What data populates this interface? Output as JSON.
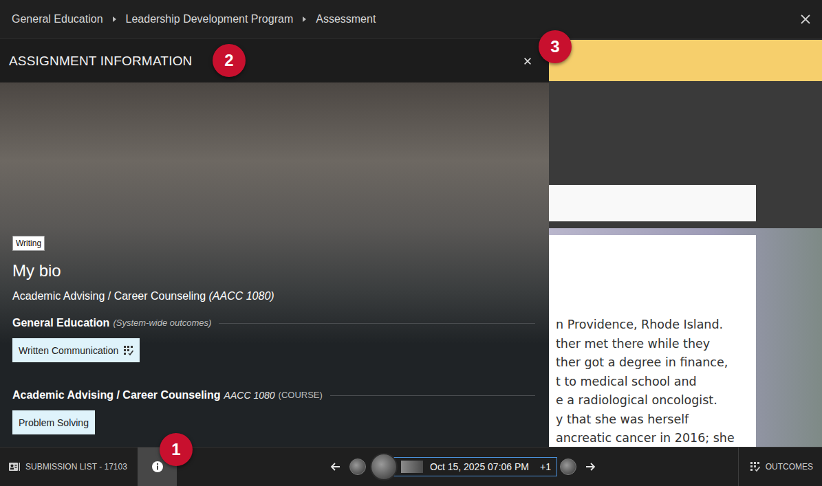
{
  "breadcrumbs": [
    "General Education",
    "Leadership Development Program",
    "Assessment"
  ],
  "panel": {
    "title": "ASSIGNMENT INFORMATION",
    "badge": "2",
    "close_badge": "3",
    "assignment": {
      "tag": "Writing",
      "title": "My bio",
      "course": "Academic Advising / Career Counseling",
      "code": "(AACC 1080)"
    },
    "sections": [
      {
        "title": "General Education",
        "note": "(System-wide outcomes)",
        "outcomes": [
          {
            "label": "Written Communication",
            "rubric": true
          }
        ]
      },
      {
        "title": "Academic Advising / Career Counseling",
        "code": "AACC 1080",
        "note": "(COURSE)",
        "outcomes": [
          {
            "label": "Problem Solving",
            "rubric": false
          }
        ]
      }
    ]
  },
  "document": {
    "lines": [
      "n Providence, Rhode Island.",
      "ther met there while they",
      "ther got a degree in finance,",
      "t to medical school and",
      "e a radiological oncologist.",
      "y that she was herself",
      "ancreatic cancer in 2016; she"
    ]
  },
  "bottom_bar": {
    "submission_list": "SUBMISSION LIST - 17103",
    "info": {
      "selected": true,
      "badge": "1"
    },
    "submissions": [
      {
        "selected": false
      },
      {
        "selected": true,
        "date": "Oct 15, 2025 07:06 PM",
        "more": "+1"
      },
      {
        "selected": false
      }
    ],
    "outcomes": "OUTCOMES"
  }
}
